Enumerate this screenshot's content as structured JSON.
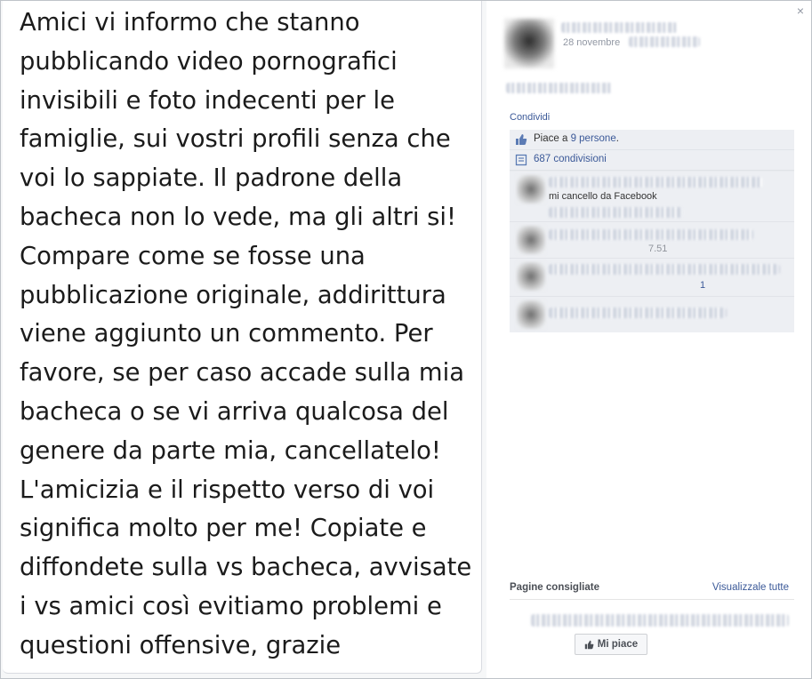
{
  "post": {
    "text_lines": [
      "Amici vi informo che stanno",
      "pubblicando video pornografici",
      "invisibili e foto indecenti per le",
      "famiglie, sui vostri profili senza che",
      "voi lo sappiate. Il padrone della",
      "bacheca non lo vede, ma gli altri si!",
      "Compare come se fosse una",
      "pubblicazione originale, addirittura",
      "viene aggiunto un commento. Per",
      "favore, se per caso accade sulla mia",
      "bacheca o se vi arriva qualcosa del",
      "genere da parte mia, cancellatelo!",
      "L'amicizia e il rispetto verso di voi",
      "significa molto per me! Copiate e",
      "diffondete sulla vs bacheca, avvisate",
      "i vs amici così evitiamo problemi e",
      "questioni offensive, grazie"
    ]
  },
  "sidebar": {
    "close_icon": "×",
    "date": "28 novembre",
    "share_label": "Condividi",
    "likes_prefix": "Piace a ",
    "likes_link": "9 persone",
    "likes_suffix": ".",
    "shares_label": "687 condivisioni",
    "comment_1_text": "mi cancello da Facebook",
    "comment_2_meta": "7.51",
    "comment_3_meta": "1",
    "pages_title": "Pagine consigliate",
    "pages_all_label": "Visualizzale tutte",
    "like_button_label": "Mi piace"
  },
  "colors": {
    "link": "#3b5998",
    "muted": "#9197a3",
    "ufi_background": "#edeff3"
  }
}
